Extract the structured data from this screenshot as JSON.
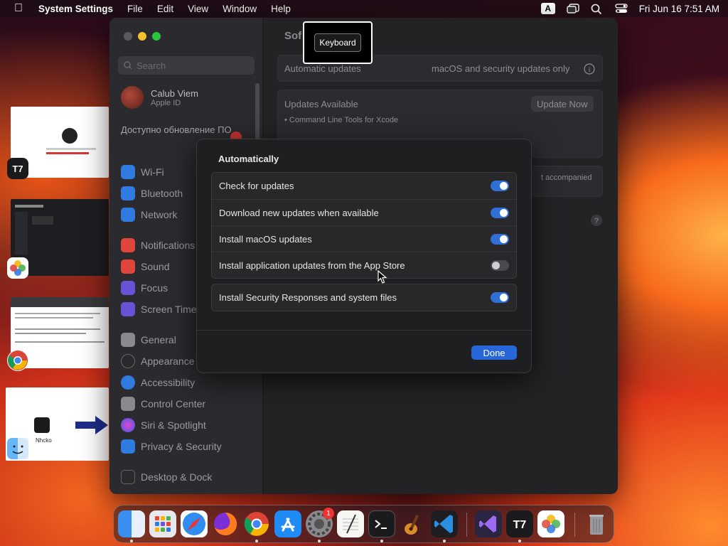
{
  "menubar": {
    "app_name": "System Settings",
    "menus": [
      "File",
      "Edit",
      "View",
      "Window",
      "Help"
    ],
    "input_source": "A",
    "datetime": "Fri Jun 16  7:51 AM"
  },
  "overlay": {
    "keystroke": "Keyboard"
  },
  "sidebar": {
    "search_placeholder": "Search",
    "user_name": "Calub Viem",
    "user_sub": "Apple ID",
    "update_notice": "Доступно обновление ПО",
    "items": [
      {
        "label": "Wi-Fi",
        "color": "#2f7be0"
      },
      {
        "label": "Bluetooth",
        "color": "#2f7be0"
      },
      {
        "label": "Network",
        "color": "#2f7be0"
      },
      {
        "label": "Notifications",
        "color": "#e0463b"
      },
      {
        "label": "Sound",
        "color": "#e0463b"
      },
      {
        "label": "Focus",
        "color": "#6a52d6"
      },
      {
        "label": "Screen Time",
        "color": "#6a52d6"
      },
      {
        "label": "General",
        "color": "#8a8a8e"
      },
      {
        "label": "Appearance",
        "color": "#2a2a2c"
      },
      {
        "label": "Accessibility",
        "color": "#2f7be0"
      },
      {
        "label": "Control Center",
        "color": "#8a8a8e"
      },
      {
        "label": "Siri & Spotlight",
        "color": "#c04ad6"
      },
      {
        "label": "Privacy & Security",
        "color": "#2f7be0"
      },
      {
        "label": "Desktop & Dock",
        "color": "#2a2a2c"
      }
    ]
  },
  "content": {
    "title_partial": "Sof",
    "automatic_updates_label": "Automatic updates",
    "automatic_updates_value": "macOS and security updates only",
    "updates_available_label": "Updates Available",
    "update_now": "Update Now",
    "update_item": "• Command Line Tools for Xcode",
    "partial_text": "t accompanied"
  },
  "sheet": {
    "title": "Automatically",
    "options": [
      {
        "label": "Check for updates",
        "enabled": true
      },
      {
        "label": "Download new updates when available",
        "enabled": true
      },
      {
        "label": "Install macOS updates",
        "enabled": true
      },
      {
        "label": "Install application updates from the App Store",
        "enabled": false
      }
    ],
    "security_option": {
      "label": "Install Security Responses and system files",
      "enabled": true
    },
    "done_label": "Done"
  },
  "thumbnails": {
    "thumb4_caption": "Nhcko"
  },
  "dock": {
    "settings_badge": "1"
  }
}
